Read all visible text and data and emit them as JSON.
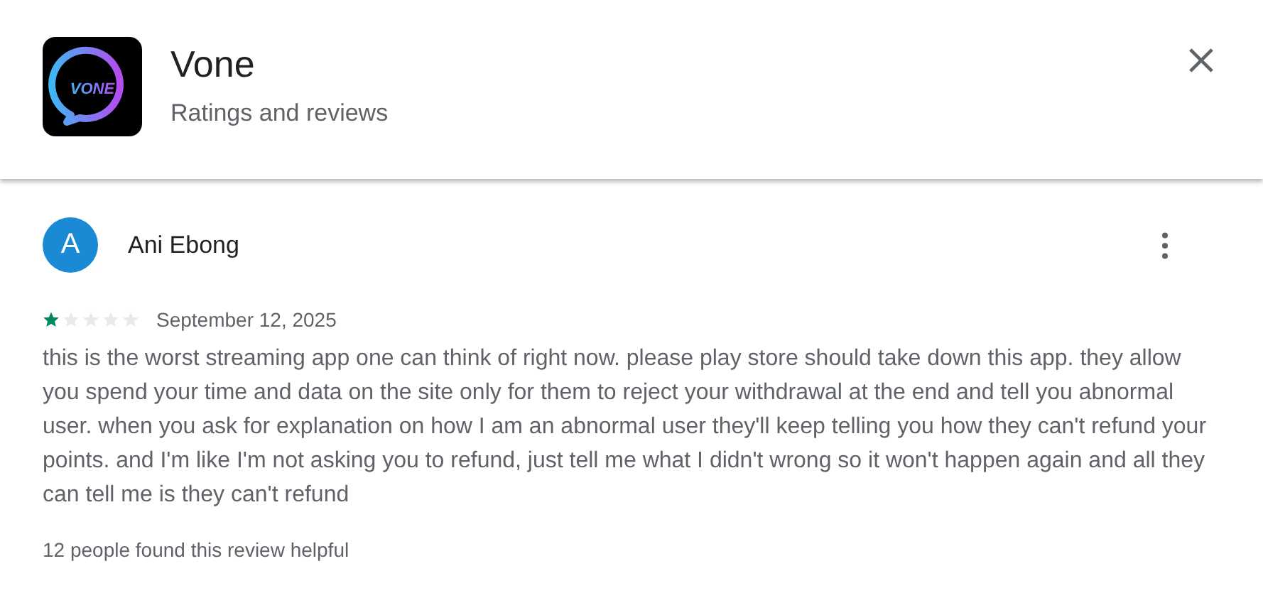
{
  "app": {
    "logo_text": "VONE",
    "name": "Vone",
    "subtitle": "Ratings and reviews"
  },
  "review": {
    "avatar_letter": "A",
    "author": "Ani Ebong",
    "stars": 1,
    "date": "September 12, 2025",
    "text": "this is the worst streaming app one can think of right now. please play store should take down this app. they allow you spend your time and data on the site only for them to reject your withdrawal at the end and tell you abnormal user. when you ask for explanation on how I am an abnormal user they'll keep telling you how they can't refund your points. and I'm like I'm not asking you to refund, just tell me what I didn't wrong so it won't happen again and all they can tell me is they can't refund",
    "helpful": "12 people found this review helpful"
  }
}
